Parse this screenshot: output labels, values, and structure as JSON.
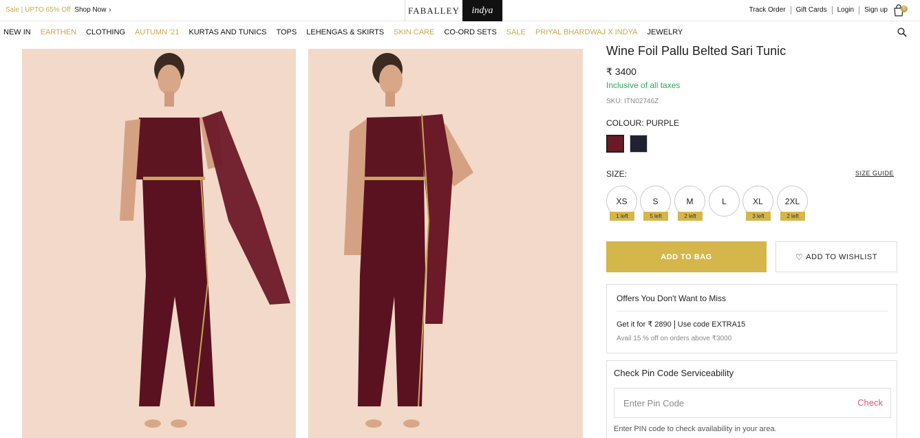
{
  "topbar": {
    "promo_sale": "Sale | UPTO 65% Off",
    "promo_shop": "Shop Now",
    "brand_1": "FABALLEY",
    "brand_2": "indya",
    "links": [
      "Track Order",
      "Gift Cards",
      "Login",
      "Sign up"
    ],
    "bag_count": "0"
  },
  "nav": {
    "items": [
      {
        "label": "NEW IN",
        "accent": false
      },
      {
        "label": "EARTHEN",
        "accent": true
      },
      {
        "label": "CLOTHING",
        "accent": false
      },
      {
        "label": "AUTUMN '21",
        "accent": true
      },
      {
        "label": "KURTAS AND TUNICS",
        "accent": false
      },
      {
        "label": "TOPS",
        "accent": false
      },
      {
        "label": "LEHENGAS & SKIRTS",
        "accent": false
      },
      {
        "label": "SKIN CARE",
        "accent": true
      },
      {
        "label": "CO-ORD SETS",
        "accent": false
      },
      {
        "label": "SALE",
        "accent": true
      },
      {
        "label": "PRIYAL BHARDWAJ X INDYA",
        "accent": true
      },
      {
        "label": "JEWELRY",
        "accent": false
      }
    ]
  },
  "product": {
    "title": "Wine Foil Pallu Belted Sari Tunic",
    "price": "₹ 3400",
    "taxes": "Inclusive of all taxes",
    "sku": "SKU: ITN02746Z",
    "colour_label": "COLOUR:",
    "colour_value": "PURPLE",
    "swatches": [
      "#6a1a26",
      "#1f2233"
    ],
    "size_label": "SIZE:",
    "size_guide": "SIZE GUIDE",
    "sizes": [
      {
        "label": "XS",
        "stock": "1 left"
      },
      {
        "label": "S",
        "stock": "5 left"
      },
      {
        "label": "M",
        "stock": "2 left"
      },
      {
        "label": "L",
        "stock": ""
      },
      {
        "label": "XL",
        "stock": "3 left"
      },
      {
        "label": "2XL",
        "stock": "2 left"
      }
    ],
    "add_to_bag": "ADD TO BAG",
    "add_to_wishlist": "ADD TO WISHLIST"
  },
  "offers": {
    "title": "Offers You Don't Want to Miss",
    "line_price": "Get it for ₹ 2890",
    "line_code": "Use code EXTRA15",
    "sub": "Avail 15 % off on orders above ₹3000"
  },
  "pincode": {
    "title": "Check Pin Code Serviceability",
    "placeholder": "Enter Pin Code",
    "check": "Check",
    "help": "Enter PIN code to check availability in your area."
  },
  "colors": {
    "accent_gold": "#d4b64a",
    "wine": "#6a1a26",
    "green": "#2cab5a",
    "pink": "#e0567a"
  }
}
